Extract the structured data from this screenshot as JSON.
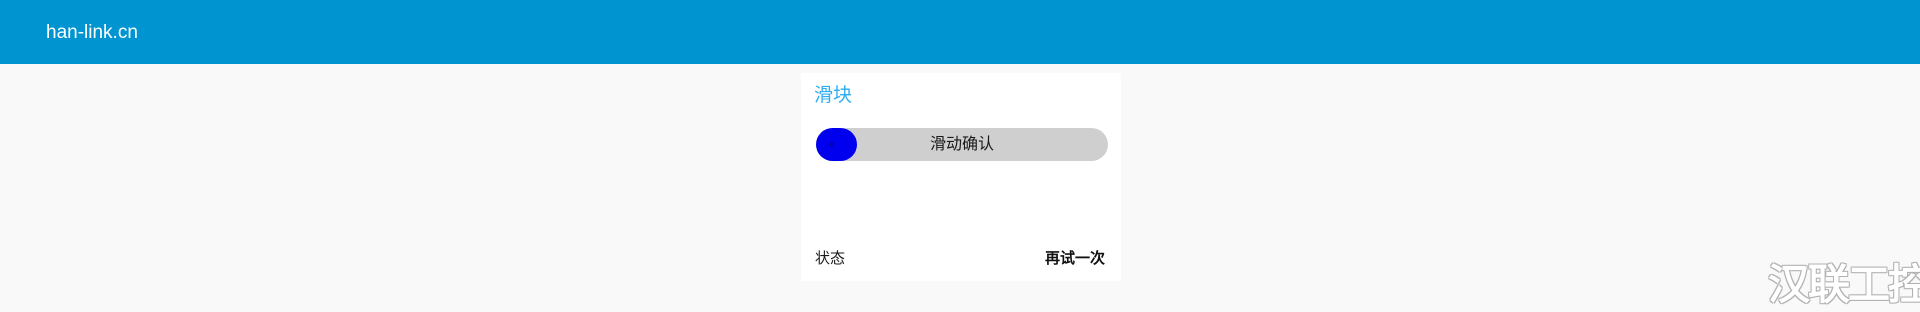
{
  "header": {
    "brand": "han-link.cn",
    "color": "#0095d0"
  },
  "card": {
    "title": "滑块",
    "slider": {
      "label": "滑动确认",
      "arrow_icon": "double-chevron-right-icon",
      "arrow_glyph": "»",
      "progress": 0.14,
      "handle_color": "#0000ee",
      "track_color": "#cfcfcf"
    },
    "footer": {
      "status_label": "状态",
      "retry_label": "再试一次"
    }
  },
  "watermark": "汉联工控吧"
}
